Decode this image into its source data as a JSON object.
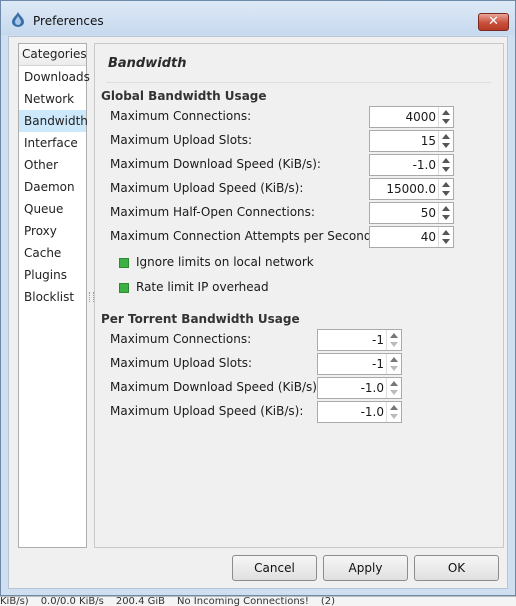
{
  "window": {
    "title": "Preferences",
    "close_label": "✕"
  },
  "categories": {
    "header": "Categories",
    "selected_index": 2,
    "items": [
      "Downloads",
      "Network",
      "Bandwidth",
      "Interface",
      "Other",
      "Daemon",
      "Queue",
      "Proxy",
      "Cache",
      "Plugins",
      "Blocklist"
    ]
  },
  "page": {
    "title": "Bandwidth"
  },
  "global": {
    "heading": "Global Bandwidth Usage",
    "fields": [
      {
        "label": "Maximum Connections:",
        "value": "4000"
      },
      {
        "label": "Maximum Upload Slots:",
        "value": "15"
      },
      {
        "label": "Maximum Download Speed (KiB/s):",
        "value": "-1.0"
      },
      {
        "label": "Maximum Upload Speed (KiB/s):",
        "value": "15000.0"
      },
      {
        "label": "Maximum Half-Open Connections:",
        "value": "50"
      },
      {
        "label": "Maximum Connection Attempts per Second:",
        "value": "40"
      }
    ],
    "checks": [
      {
        "label": "Ignore limits on local network",
        "checked": true
      },
      {
        "label": "Rate limit IP overhead",
        "checked": true
      }
    ]
  },
  "per_torrent": {
    "heading": "Per Torrent Bandwidth Usage",
    "fields": [
      {
        "label": "Maximum Connections:",
        "value": "-1"
      },
      {
        "label": "Maximum Upload Slots:",
        "value": "-1"
      },
      {
        "label": "Maximum Download Speed (KiB/s):",
        "value": "-1.0"
      },
      {
        "label": "Maximum Upload Speed (KiB/s):",
        "value": "-1.0"
      }
    ]
  },
  "buttons": {
    "cancel": "Cancel",
    "apply": "Apply",
    "ok": "OK"
  },
  "statusbar": {
    "items": [
      "KiB/s)",
      "0.0/0.0 KiB/s",
      "200.4 GiB",
      "No Incoming Connections!",
      "(2)"
    ]
  },
  "colors": {
    "selection": "#cde8fb",
    "checkbox": "#3cb043",
    "close_button": "#c9503c"
  },
  "icons": {
    "app": "deluge-droplet-icon",
    "close": "close-icon"
  }
}
